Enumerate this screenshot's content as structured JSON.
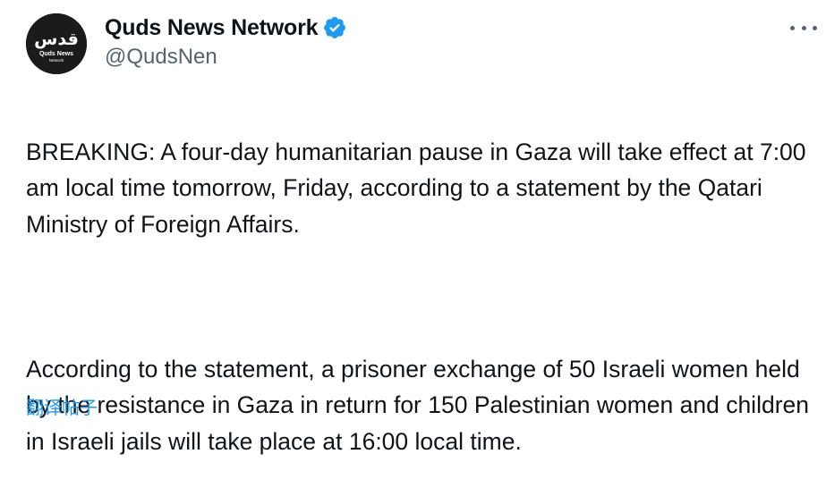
{
  "author": {
    "display_name": "Quds News Network",
    "handle": "@QudsNen",
    "verified": true,
    "avatar": {
      "logo_text": "قدس",
      "line1": "Quds News",
      "line2": "Network"
    }
  },
  "tweet": {
    "paragraph_1": "BREAKING: A four-day humanitarian pause in Gaza will take effect at 7:00 am local time tomorrow, Friday, according to a statement by the Qatari Ministry of Foreign Affairs.",
    "paragraph_2": "According to the statement, a prisoner exchange of 50 Israeli women held by the resistance in Gaza in return for 150 Palestinian women and children in Israeli jails will take place at 16:00 local time."
  },
  "translate_label": "翻译帖子",
  "icons": {
    "more": "more-icon",
    "verified": "verified-badge-icon"
  },
  "colors": {
    "text": "#0f1419",
    "secondary": "#536471",
    "link": "#1d9bf0",
    "avatar_bg": "#1b1b1b"
  }
}
